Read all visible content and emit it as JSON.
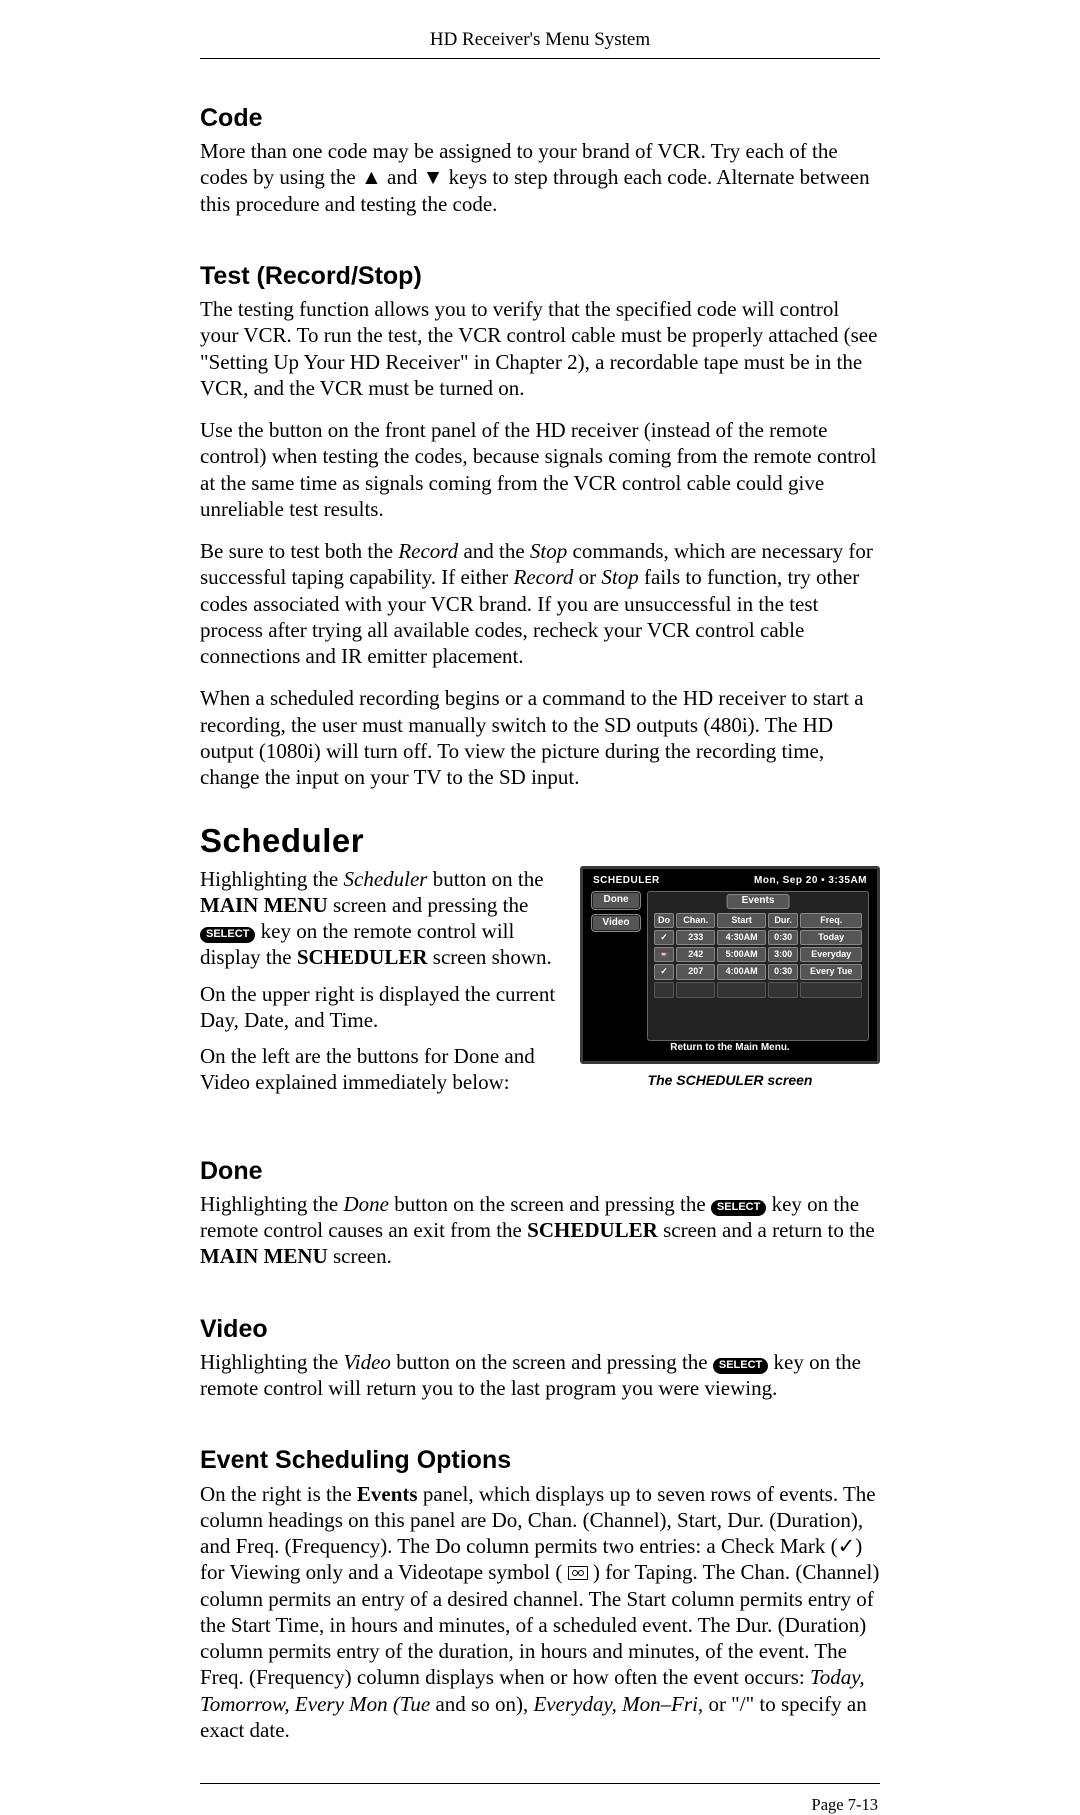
{
  "running_head": "HD Receiver's Menu System",
  "page_number": "Page 7-13",
  "code_h": "Code",
  "code_p": "More than one code may be assigned to your brand of VCR. Try each of the codes by using the ▲ and ▼ keys to step through each code. Alternate between this procedure and testing the code.",
  "test_h": "Test (Record/Stop)",
  "test_p1": "The testing function allows you to verify that the specified code will control your VCR. To run the test, the VCR control cable must be properly attached (see \"Setting Up Your HD Receiver\" in Chapter 2), a recordable tape must be in the VCR, and the VCR must be turned on.",
  "test_p2": "Use the button on the front panel of the HD receiver (instead of the remote control) when testing the codes, because signals coming from the remote control at the same time as signals coming from the VCR control cable could give unreliable test results.",
  "test_p3_a": "Be sure to test both the ",
  "test_p3_rec": "Record",
  "test_p3_b": " and the ",
  "test_p3_stop": "Stop",
  "test_p3_c": " commands, which are necessary for successful taping capability. If either ",
  "test_p3_rec2": "Record",
  "test_p3_d": " or ",
  "test_p3_stop2": "Stop",
  "test_p3_e": " fails to function, try other codes associated with your VCR brand. If you are unsuccessful in the test process after trying all available codes, recheck your VCR control cable connections and IR emitter placement.",
  "test_p4": "When a scheduled recording begins or a command to the HD receiver to start a recording, the user must manually switch to the SD outputs (480i). The HD output (1080i) will turn off. To view the picture during the recording time, change the input on your TV to the SD input.",
  "sched_h": "Scheduler",
  "sched_p1_a": "Highlighting the ",
  "sched_p1_sched": "Scheduler",
  "sched_p1_b": " button on the ",
  "sched_p1_mm": "MAIN MENU",
  "sched_p1_c": " screen and pressing the ",
  "select_key": "SELECT",
  "sched_p1_d": " key on the remote control will display the ",
  "sched_p1_scr": "SCHEDULER",
  "sched_p1_e": " screen shown.",
  "sched_p2": "On the upper right is displayed the current Day, Date, and Time.",
  "sched_p3": "On the left are the buttons for Done and Video explained immediately below:",
  "fig": {
    "caption": "The SCHEDULER screen",
    "title": "SCHEDULER",
    "datetime": "Mon, Sep 20 • 3:35AM",
    "left_buttons": [
      "Done",
      "Video"
    ],
    "events_label": "Events",
    "columns": [
      "Do",
      "Chan.",
      "Start",
      "Dur.",
      "Freq."
    ],
    "rows": [
      {
        "do": "✓",
        "chan": "233",
        "start": "4:30AM",
        "dur": "0:30",
        "freq": "Today"
      },
      {
        "do": "📼",
        "chan": "242",
        "start": "5:00AM",
        "dur": "3:00",
        "freq": "Everyday"
      },
      {
        "do": "✓",
        "chan": "207",
        "start": "4:00AM",
        "dur": "0:30",
        "freq": "Every Tue"
      }
    ],
    "footer": "Return to the Main Menu."
  },
  "done_h": "Done",
  "done_p_a": "Highlighting the ",
  "done_p_done": "Done",
  "done_p_b": " button on the screen and pressing the ",
  "done_p_c": " key on the remote control causes an exit from the ",
  "done_p_scr": "SCHEDULER",
  "done_p_d": " screen and a return to the ",
  "done_p_mm": "MAIN MENU",
  "done_p_e": " screen.",
  "video_h": "Video",
  "video_p_a": "Highlighting the ",
  "video_p_video": "Video",
  "video_p_b": " button on the screen and pressing the ",
  "video_p_c": " key on the remote control will return you to the last program you were viewing.",
  "eso_h": "Event Scheduling Options",
  "eso_p_a": "On the right is the ",
  "eso_p_events": "Events",
  "eso_p_b": " panel, which displays up to seven rows of events. The column headings on this panel are Do, Chan. (Channel), Start, Dur. (Duration), and Freq. (Frequency). The Do column permits two entries: a Check Mark (✓) for Viewing only and a Videotape symbol ( ",
  "eso_p_c": " ) for Taping. The Chan. (Channel) column permits an entry of a desired channel. The Start column permits entry of the Start Time, in hours and minutes, of a scheduled event. The Dur. (Duration) column permits entry of the duration, in hours and minutes, of the event. The Freq. (Frequency) column displays when or how often the event occurs: ",
  "eso_p_em1": "Today, Tomorrow, Every Mon (Tue",
  "eso_p_d": " and so on), ",
  "eso_p_em2": "Everyday, Mon–Fri,",
  "eso_p_e": " or \"/\" to specify an exact date."
}
